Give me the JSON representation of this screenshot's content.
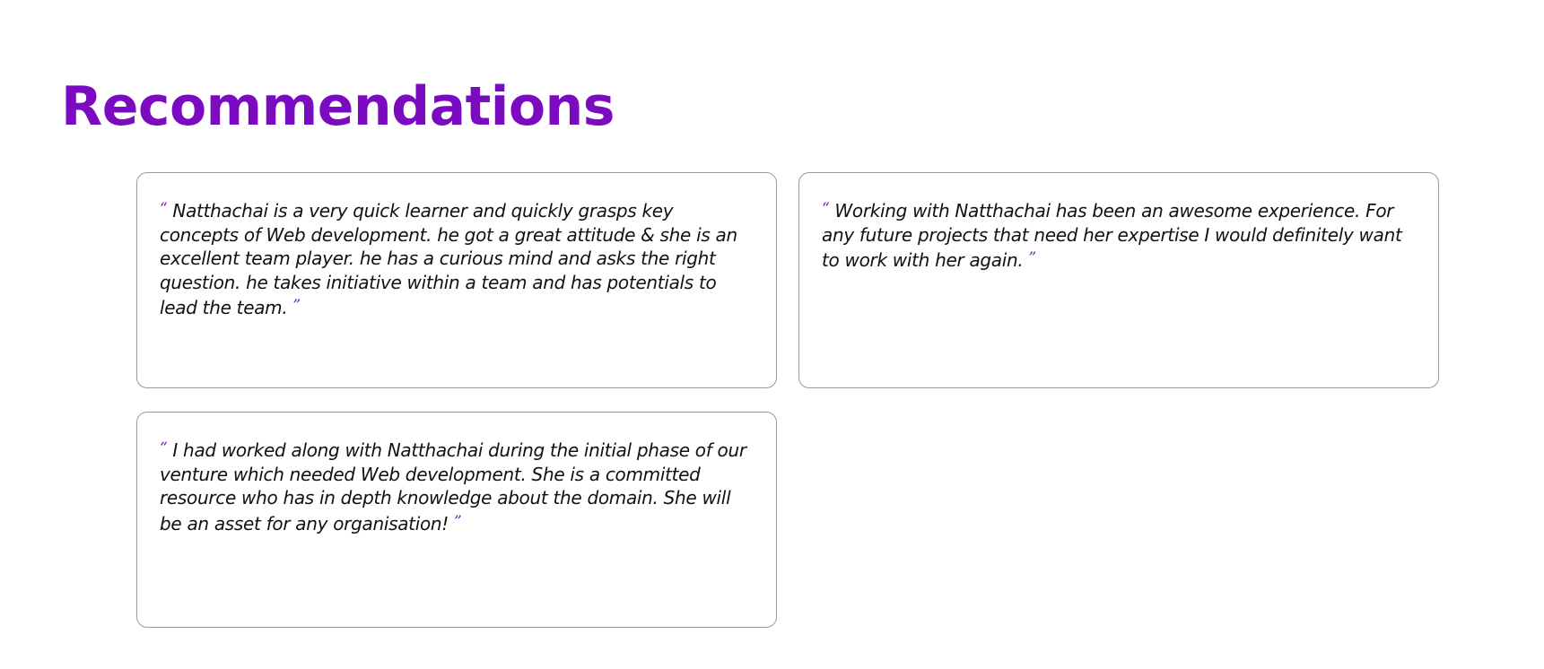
{
  "section": {
    "title": "Recommendations"
  },
  "quote_marks": {
    "open": "“",
    "close": "”",
    "color": "#7a0bc0"
  },
  "recommendations": [
    {
      "text": "Natthachai is a very quick learner and quickly grasps key concepts of Web development. he got a great attitude & she is an excellent team player. he has a curious mind and asks the right question. he takes initiative within a team and has potentials to lead the team."
    },
    {
      "text": "Working with Natthachai has been an awesome experience. For any future projects that need her expertise I would definitely want to work with her again."
    },
    {
      "text": "I had worked along with Natthachai during the initial phase of our venture which needed Web development. She is a committed resource who has in depth knowledge about the domain. She will be an asset for any organisation!"
    }
  ]
}
